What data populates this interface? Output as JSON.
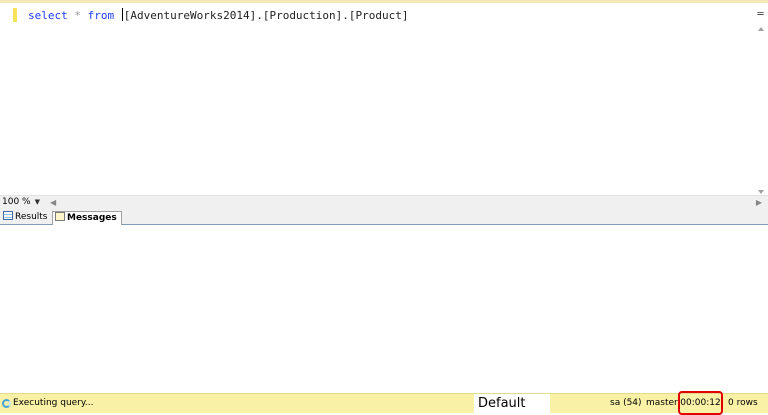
{
  "editor": {
    "query": {
      "keyword_select": "select",
      "star": "*",
      "keyword_from": "from",
      "object": "[AdventureWorks2014].[Production].[Product]"
    }
  },
  "zoom": {
    "value": "100 %"
  },
  "tabs": [
    {
      "label": "Results"
    },
    {
      "label": "Messages"
    }
  ],
  "status": {
    "message": "Executing query...",
    "connection_color": "Default",
    "user": "sa (54)",
    "database": "master",
    "elapsed": "00:00:12",
    "rows": "0 rows"
  },
  "colors": {
    "keyword": "#1f3cff",
    "status_bar": "#f9f1a6",
    "highlight_box": "#e00000"
  },
  "icons": [
    "spinner-icon",
    "results-grid-icon",
    "messages-icon",
    "split-icon"
  ]
}
